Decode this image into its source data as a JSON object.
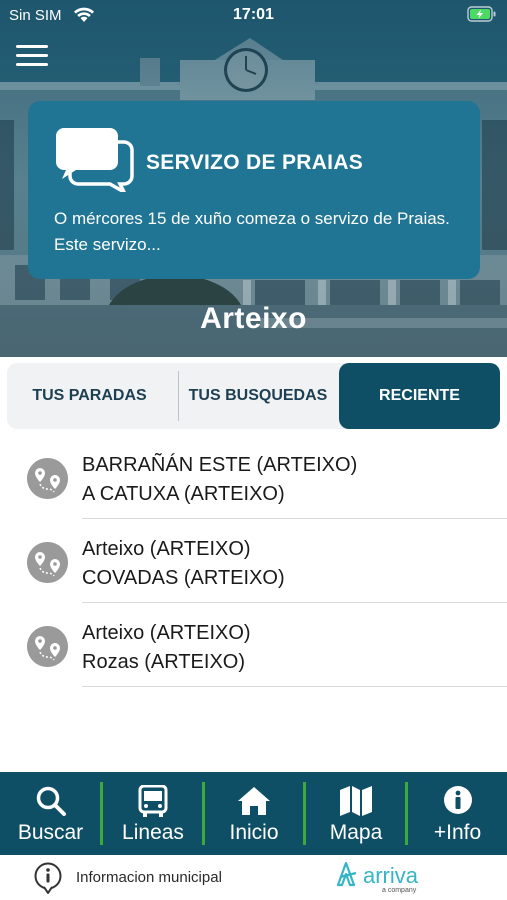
{
  "status_bar": {
    "carrier": "Sin SIM",
    "time": "17:01"
  },
  "hero": {
    "news": {
      "title": "SERVIZO DE PRAIAS",
      "text": "O mércores 15 de xuño comeza o servizo de Praias. Este servizo..."
    },
    "logo_text": "Arteixo"
  },
  "tabs": [
    {
      "label": "TUS PARADAS",
      "active": false
    },
    {
      "label": "TUS BUSQUEDAS",
      "active": false
    },
    {
      "label": "RECIENTE",
      "active": true
    }
  ],
  "recent_routes": [
    {
      "from": "BARRAÑÁN ESTE (ARTEIXO)",
      "to": "A CATUXA (ARTEIXO)"
    },
    {
      "from": "Arteixo (ARTEIXO)",
      "to": "COVADAS (ARTEIXO)"
    },
    {
      "from": "Arteixo (ARTEIXO)",
      "to": "Rozas (ARTEIXO)"
    }
  ],
  "bottom_nav": [
    {
      "label": "Buscar",
      "icon": "search-icon"
    },
    {
      "label": "Lineas",
      "icon": "bus-icon"
    },
    {
      "label": "Inicio",
      "icon": "home-icon"
    },
    {
      "label": "Mapa",
      "icon": "map-icon"
    },
    {
      "label": "+Info",
      "icon": "info-icon"
    }
  ],
  "footer": {
    "label": "Informacion municipal",
    "brand": "arriva",
    "brand_sub": "a company"
  },
  "colors": {
    "primary": "#0f4f65",
    "news_card": "#207594",
    "separator": "#3fa83a",
    "brand": "#35b5c6"
  }
}
